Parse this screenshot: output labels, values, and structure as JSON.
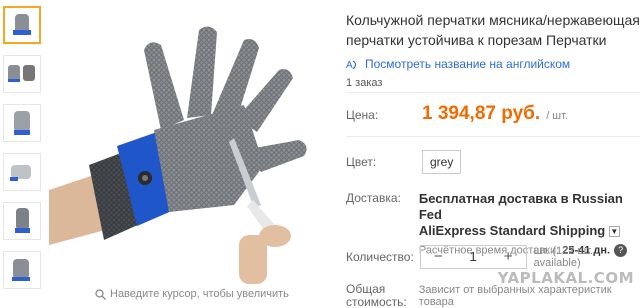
{
  "product": {
    "title": "Кольчужной перчатки мясника/нержавеющая перчатки устойчива к порезам Перчатки",
    "translate_link": "Посмотреть название на английском",
    "orders": "1 заказ"
  },
  "gallery": {
    "thumbnails": [
      "glove-thumb-1",
      "glove-thumb-2",
      "glove-thumb-3",
      "glove-thumb-4",
      "glove-thumb-5",
      "glove-thumb-6"
    ],
    "active_index": 0,
    "zoom_hint": "Наведите курсор, чтобы увеличить"
  },
  "price": {
    "label": "Цена:",
    "value": "1 394,87 руб.",
    "unit": "/ шт.",
    "color": "#f56a00"
  },
  "color": {
    "label": "Цвет:",
    "selected": "grey"
  },
  "shipping": {
    "label": "Доставка:",
    "free_text": "Бесплатная доставка",
    "to_text": "в Russian Fed",
    "method": "AliExpress Standard Shipping",
    "eta_label": "Расчётное время доставки:",
    "eta_value": "25-41 дн."
  },
  "quantity": {
    "label": "Количество:",
    "value": "1",
    "minus": "−",
    "plus": "+",
    "available": "шт. (122 шт. available)"
  },
  "total": {
    "label": "Общая стоимость:",
    "value": "Зависит от выбранных характеристик товара"
  },
  "watermark": "YAPLAKAL.COM",
  "icons": {
    "zoom": "magnifier-icon",
    "translate": "translate-icon",
    "dropdown": "chevron-down-icon",
    "help": "question-icon"
  }
}
